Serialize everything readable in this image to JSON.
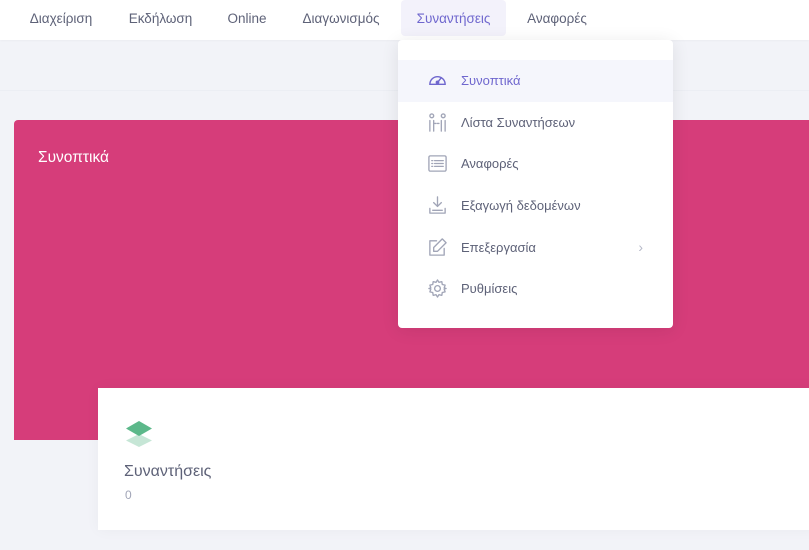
{
  "topnav": {
    "items": [
      {
        "label": "Διαχείριση"
      },
      {
        "label": "Εκδήλωση"
      },
      {
        "label": "Online"
      },
      {
        "label": "Διαγωνισμός"
      },
      {
        "label": "Συναντήσεις"
      },
      {
        "label": "Αναφορές"
      }
    ]
  },
  "banner": {
    "title": "Συνοπτικά"
  },
  "dropdown": {
    "items": [
      {
        "label": "Συνοπτικά",
        "icon": "dashboard-gauge-icon"
      },
      {
        "label": "Λίστα Συναντήσεων",
        "icon": "people-meeting-icon"
      },
      {
        "label": "Αναφορές",
        "icon": "list-report-icon"
      },
      {
        "label": "Εξαγωγή δεδομένων",
        "icon": "export-download-icon"
      },
      {
        "label": "Επεξεργασία",
        "icon": "edit-pencil-icon"
      },
      {
        "label": "Ρυθμίσεις",
        "icon": "gear-icon"
      }
    ]
  },
  "stats": {
    "label": "Συναντήσεις",
    "value": "0",
    "icon": "layers-icon"
  },
  "colors": {
    "accent": "#6f67ce",
    "banner": "#d63d7a",
    "icon_green": "#5cb88a"
  }
}
